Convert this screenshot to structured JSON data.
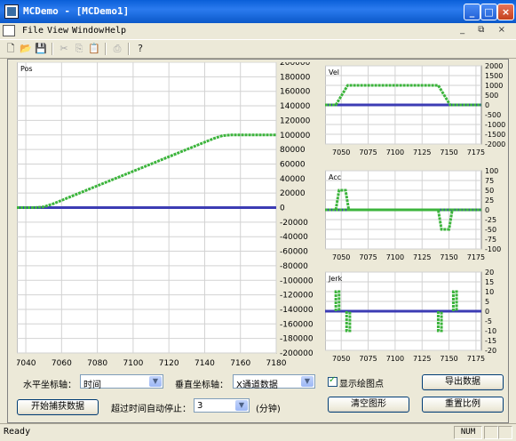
{
  "window": {
    "title": "MCDemo - [MCDemo1]"
  },
  "menu": [
    {
      "label": "File",
      "accel": "F"
    },
    {
      "label": "View",
      "accel": "V"
    },
    {
      "label": "Window",
      "accel": "W"
    },
    {
      "label": "Help",
      "accel": "H"
    }
  ],
  "toolbar": [
    "new-icon",
    "open-icon",
    "save-icon",
    "cut-icon",
    "copy-icon",
    "paste-icon",
    "print-icon",
    "help-icon"
  ],
  "colors": {
    "zero_line": "#3c3cb4",
    "trace": "#3cb43c",
    "grid": "#d2d2d2"
  },
  "chart_data": [
    {
      "type": "line",
      "title": "Pos",
      "xlim": [
        7035,
        7180
      ],
      "ylim": [
        -200000,
        200000
      ],
      "xticks": [
        7040,
        7060,
        7080,
        7100,
        7120,
        7140,
        7160,
        7180
      ],
      "yticks": [
        200000,
        180000,
        160000,
        140000,
        120000,
        100000,
        80000,
        60000,
        40000,
        20000,
        0,
        -20000,
        -40000,
        -60000,
        -80000,
        -100000,
        -120000,
        -140000,
        -160000,
        -180000,
        -200000
      ],
      "zero_line": 0,
      "series": [
        {
          "x": [
            7035,
            7045,
            7050,
            7055,
            7145,
            7150,
            7155,
            7160,
            7180
          ],
          "y": [
            0,
            0,
            1000,
            5000,
            95000,
            99000,
            100000,
            100000,
            100000
          ]
        }
      ]
    },
    {
      "type": "line",
      "title": "Vel",
      "xlim": [
        7035,
        7180
      ],
      "ylim": [
        -2000,
        2000
      ],
      "xticks": [
        7050,
        7075,
        7100,
        7125,
        7150,
        7175
      ],
      "yticks": [
        2000,
        1500,
        1000,
        500,
        0,
        -500,
        -1000,
        -1500,
        -2000
      ],
      "zero_line": 0,
      "series": [
        {
          "x": [
            7035,
            7045,
            7056,
            7140,
            7151,
            7180
          ],
          "y": [
            0,
            0,
            1000,
            1000,
            0,
            0
          ]
        }
      ]
    },
    {
      "type": "line",
      "title": "Acc",
      "xlim": [
        7035,
        7180
      ],
      "ylim": [
        -100,
        100
      ],
      "xticks": [
        7050,
        7075,
        7100,
        7125,
        7150,
        7175
      ],
      "yticks": [
        100,
        75,
        50,
        25,
        0,
        -25,
        -50,
        -75,
        -100
      ],
      "zero_line": 0,
      "series": [
        {
          "x": [
            7035,
            7045,
            7048,
            7054,
            7057,
            7180
          ],
          "y": [
            0,
            0,
            50,
            50,
            0,
            0
          ]
        },
        {
          "x": [
            7035,
            7140,
            7143,
            7150,
            7153,
            7180
          ],
          "y": [
            0,
            0,
            -50,
            -50,
            0,
            0
          ]
        }
      ]
    },
    {
      "type": "line",
      "title": "Jerk",
      "xlim": [
        7035,
        7180
      ],
      "ylim": [
        -20,
        20
      ],
      "xticks": [
        7050,
        7075,
        7100,
        7125,
        7150,
        7175
      ],
      "yticks": [
        20,
        15,
        10,
        5,
        0,
        -5,
        -10,
        -15,
        -20
      ],
      "zero_line": 0,
      "series": [
        {
          "x": [
            7045,
            7045,
            7048,
            7048
          ],
          "y": [
            0,
            10,
            10,
            0
          ]
        },
        {
          "x": [
            7055,
            7055,
            7058,
            7058
          ],
          "y": [
            0,
            -10,
            -10,
            0
          ]
        },
        {
          "x": [
            7140,
            7140,
            7143,
            7143
          ],
          "y": [
            0,
            -10,
            -10,
            0
          ]
        },
        {
          "x": [
            7154,
            7154,
            7157,
            7157
          ],
          "y": [
            0,
            10,
            10,
            0
          ]
        }
      ]
    }
  ],
  "controls": {
    "h_axis_label": "水平坐标轴：",
    "h_axis_value": "时间",
    "v_axis_label": "垂直坐标轴：",
    "v_axis_value": "X通道数据",
    "show_points_label": "显示绘图点",
    "export_button": "导出数据",
    "start_capture_button": "开始捕获数据",
    "timeout_label": "超过时间自动停止：",
    "timeout_value": "3",
    "timeout_unit": "(分钟)",
    "clear_button": "清空图形",
    "reset_scale_button": "重置比例"
  },
  "status": {
    "text": "Ready",
    "num": "NUM"
  }
}
